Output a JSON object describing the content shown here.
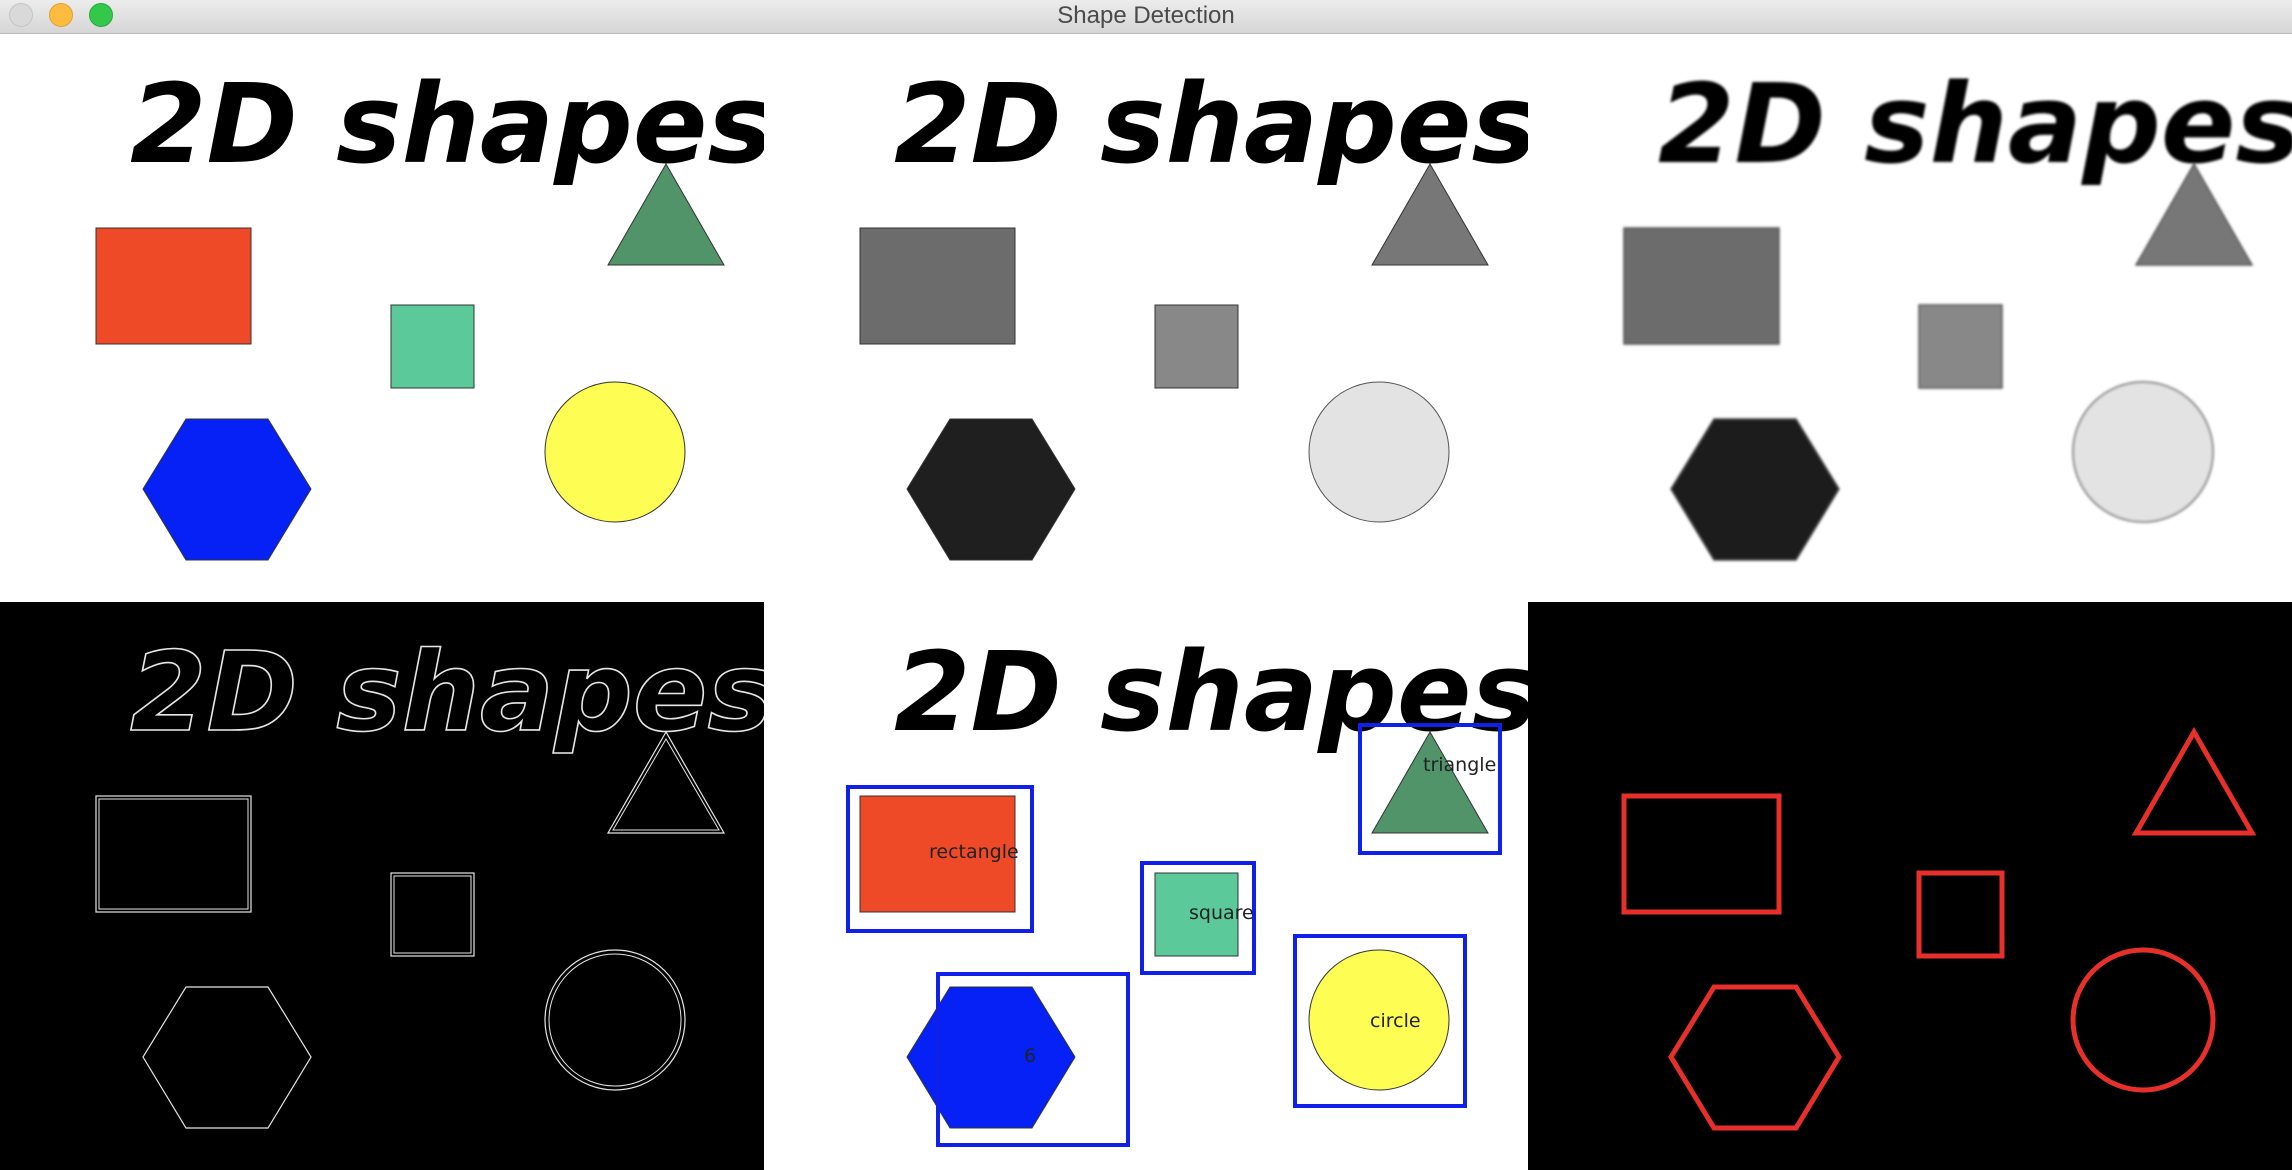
{
  "window": {
    "title": "Shape Detection"
  },
  "panels": {
    "heading": "2D shapes"
  },
  "detection": {
    "labels": {
      "rectangle": "rectangle",
      "square": "square",
      "triangle": "triangle",
      "circle": "circle",
      "hexagon": "6"
    }
  },
  "colors": {
    "rectangle": "#ef4a27",
    "triangle": "#52946a",
    "square": "#5bc999",
    "circle": "#fefd53",
    "hexagon": "#0521f5",
    "bounding_box": "#1020e8",
    "contour": "#e8302a",
    "gray_rectangle": "#6c6c6c",
    "gray_triangle": "#777777",
    "gray_square": "#888888",
    "gray_circle": "#e3e3e3",
    "gray_hexagon": "#1f1f1f"
  }
}
